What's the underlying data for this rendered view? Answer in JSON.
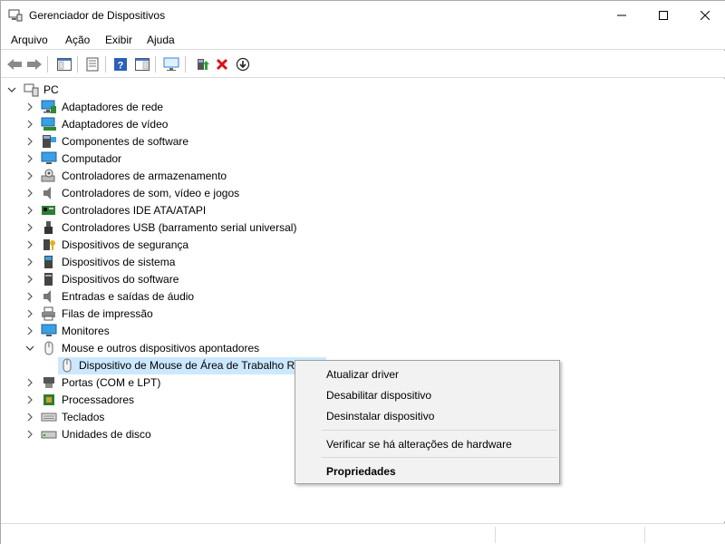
{
  "window": {
    "title": "Gerenciador de Dispositivos"
  },
  "menu": [
    "Arquivo",
    "Ação",
    "Exibir",
    "Ajuda"
  ],
  "tree": {
    "root": "PC",
    "categories": [
      "Adaptadores de rede",
      "Adaptadores de vídeo",
      "Componentes de software",
      "Computador",
      "Controladores de armazenamento",
      "Controladores de som, vídeo e jogos",
      "Controladores IDE ATA/ATAPI",
      "Controladores USB (barramento serial universal)",
      "Dispositivos de segurança",
      "Dispositivos de sistema",
      "Dispositivos do software",
      "Entradas e saídas de áudio",
      "Filas de impressão",
      "Monitores",
      "Mouse e outros dispositivos apontadores",
      "Portas (COM e LPT)",
      "Processadores",
      "Teclados",
      "Unidades de disco"
    ],
    "selected_child": "Dispositivo de Mouse de Área de Trabalho R"
  },
  "context_menu": {
    "update_driver": "Atualizar driver",
    "disable_device": "Desabilitar dispositivo",
    "uninstall_device": "Desinstalar dispositivo",
    "scan_hardware": "Verificar se há alterações de hardware",
    "properties": "Propriedades"
  },
  "colors": {
    "selection": "#cce8ff",
    "accent": "#1e90d6"
  }
}
